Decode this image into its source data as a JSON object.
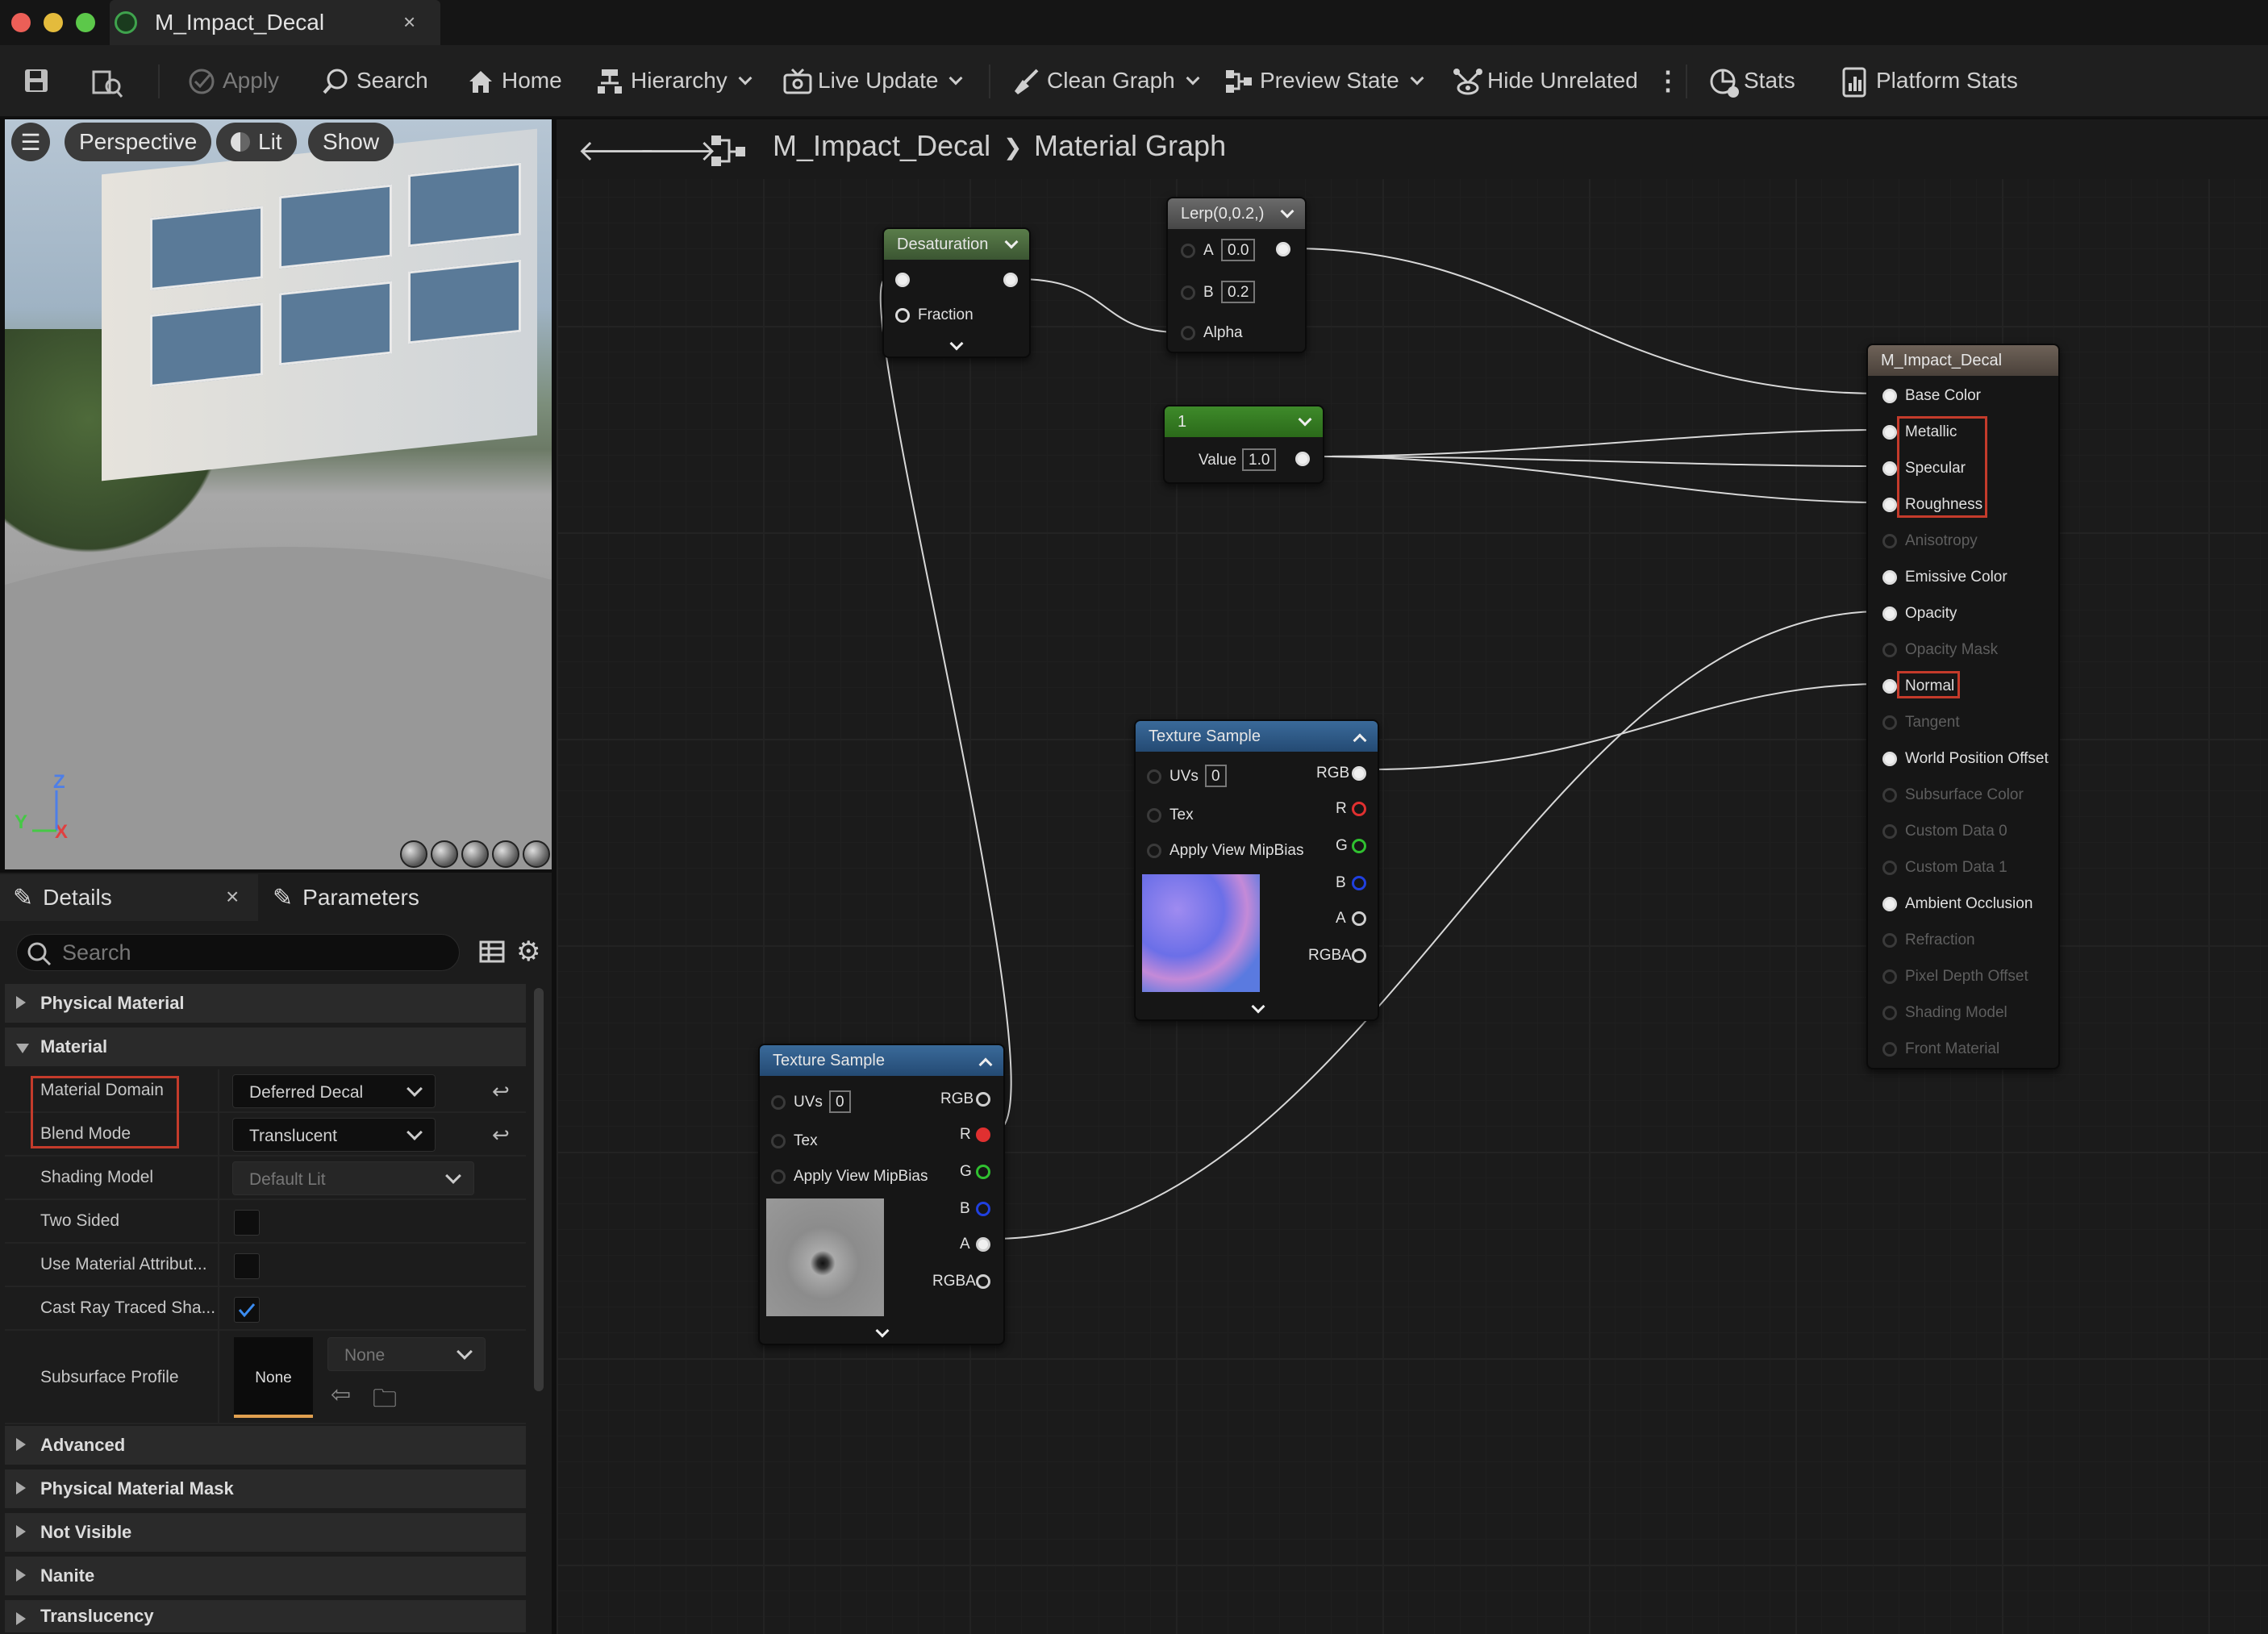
{
  "window": {
    "tab_title": "M_Impact_Decal",
    "tab_close": "×"
  },
  "toolbar": {
    "apply": "Apply",
    "search": "Search",
    "home": "Home",
    "hierarchy": "Hierarchy",
    "live_update": "Live Update",
    "clean_graph": "Clean Graph",
    "preview_state": "Preview State",
    "hide_unrelated": "Hide Unrelated",
    "stats": "Stats",
    "platform_stats": "Platform Stats"
  },
  "viewport": {
    "perspective": "Perspective",
    "lit": "Lit",
    "show": "Show",
    "axis_z": "Z",
    "axis_y": "Y",
    "axis_x": "X"
  },
  "details": {
    "tab_details": "Details",
    "tab_close": "×",
    "tab_parameters": "Parameters",
    "search_placeholder": "Search",
    "sections": {
      "physical_material": "Physical Material",
      "material": "Material",
      "advanced": "Advanced",
      "physical_material_mask": "Physical Material Mask",
      "not_visible": "Not Visible",
      "nanite": "Nanite",
      "translucency": "Translucency"
    },
    "props": {
      "material_domain": {
        "label": "Material Domain",
        "value": "Deferred Decal"
      },
      "blend_mode": {
        "label": "Blend Mode",
        "value": "Translucent"
      },
      "shading_model": {
        "label": "Shading Model",
        "value": "Default Lit"
      },
      "two_sided": {
        "label": "Two Sided",
        "checked": false
      },
      "use_material_attributes": {
        "label": "Use Material Attribut...",
        "checked": false
      },
      "cast_ray_traced": {
        "label": "Cast Ray Traced Sha...",
        "checked": true
      },
      "subsurface_profile": {
        "label": "Subsurface Profile",
        "thumb": "None",
        "value": "None"
      }
    }
  },
  "graph": {
    "breadcrumb_asset": "M_Impact_Decal",
    "breadcrumb_sep": "❯",
    "breadcrumb_graph": "Material Graph",
    "nodes": {
      "desaturation": {
        "title": "Desaturation",
        "fraction": "Fraction"
      },
      "lerp": {
        "title": "Lerp(0,0.2,)",
        "a_label": "A",
        "a_value": "0.0",
        "b_label": "B",
        "b_value": "0.2",
        "alpha": "Alpha"
      },
      "constant": {
        "title": "1",
        "value_label": "Value",
        "value": "1.0"
      },
      "texture_sample_normal": {
        "title": "Texture Sample",
        "uvs": "UVs",
        "uvs_value": "0",
        "tex": "Tex",
        "mip": "Apply View MipBias",
        "rgb": "RGB",
        "r": "R",
        "g": "G",
        "b": "B",
        "a": "A",
        "rgba": "RGBA"
      },
      "texture_sample_mask": {
        "title": "Texture Sample",
        "uvs": "UVs",
        "uvs_value": "0",
        "tex": "Tex",
        "mip": "Apply View MipBias",
        "rgb": "RGB",
        "r": "R",
        "g": "G",
        "b": "B",
        "a": "A",
        "rgba": "RGBA"
      },
      "result": {
        "title": "M_Impact_Decal",
        "inputs": [
          {
            "label": "Base Color",
            "enabled": true
          },
          {
            "label": "Metallic",
            "enabled": true
          },
          {
            "label": "Specular",
            "enabled": true
          },
          {
            "label": "Roughness",
            "enabled": true
          },
          {
            "label": "Anisotropy",
            "enabled": false
          },
          {
            "label": "Emissive Color",
            "enabled": true
          },
          {
            "label": "Opacity",
            "enabled": true
          },
          {
            "label": "Opacity Mask",
            "enabled": false
          },
          {
            "label": "Normal",
            "enabled": true
          },
          {
            "label": "Tangent",
            "enabled": false
          },
          {
            "label": "World Position Offset",
            "enabled": true
          },
          {
            "label": "Subsurface Color",
            "enabled": false
          },
          {
            "label": "Custom Data 0",
            "enabled": false
          },
          {
            "label": "Custom Data 1",
            "enabled": false
          },
          {
            "label": "Ambient Occlusion",
            "enabled": true
          },
          {
            "label": "Refraction",
            "enabled": false
          },
          {
            "label": "Pixel Depth Offset",
            "enabled": false
          },
          {
            "label": "Shading Model",
            "enabled": false
          },
          {
            "label": "Front Material",
            "enabled": false
          }
        ]
      }
    }
  },
  "colors": {
    "accent_highlight": "#c43b2b",
    "check_blue": "#3b8cf0"
  }
}
